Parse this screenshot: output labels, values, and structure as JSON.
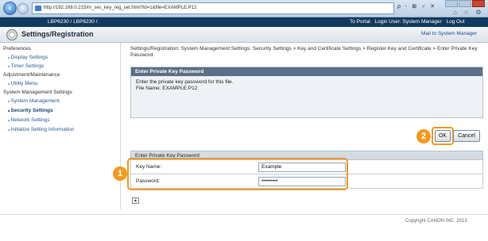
{
  "browser": {
    "address": "http://192.168.0.215/m_sec_key_reg_set.html?id=1&file=EXAMPLE.P12",
    "tools": "ρ - ⊠ ♂ ✕",
    "chrome_icons": "⌂ ☆ ⚙"
  },
  "header": {
    "device_name": "LBP6230 / LBP6230 /",
    "portal_link": "To Portal",
    "login_user": "Login User: System Manager",
    "logout": "Log Out"
  },
  "title_bar": {
    "title": "Settings/Registration",
    "mail_link": "Mail to System Manager"
  },
  "sidebar": {
    "preferences": "Preferences",
    "display_settings": "Display Settings",
    "timer_settings": "Timer Settings",
    "adjustment": "Adjustment/Maintenance",
    "utility_menu": "Utility Menu",
    "system_management_settings": "System Management Settings",
    "system_management": "System Management",
    "security_settings": "Security Settings",
    "network_settings": "Network Settings",
    "initialize": "Initialize Setting Information"
  },
  "main": {
    "breadcrumb": "Settings/Registration: System Management Settings: Security Settings > Key and Certificate Settings > Register Key and Certificate > Enter Private Key Password",
    "panel_title": "Enter Private Key Password",
    "instruction": "Enter the private key password for this file.",
    "file_name": "File Name: EXAMPLE.P12",
    "ok": "OK",
    "cancel": "Cancel",
    "section_title": "Enter Private Key Password",
    "key_name_label": "Key Name:",
    "key_name_value": "Example",
    "password_label": "Password:",
    "password_value": "•••••••••",
    "top_icon": "▲",
    "copyright": "Copyright CANON INC. 2013"
  },
  "callouts": {
    "one": "1",
    "two": "2"
  },
  "colors": {
    "header_bg": "#123a5e",
    "callout": "#f39a1f",
    "panel_head": "#5a6f86"
  }
}
